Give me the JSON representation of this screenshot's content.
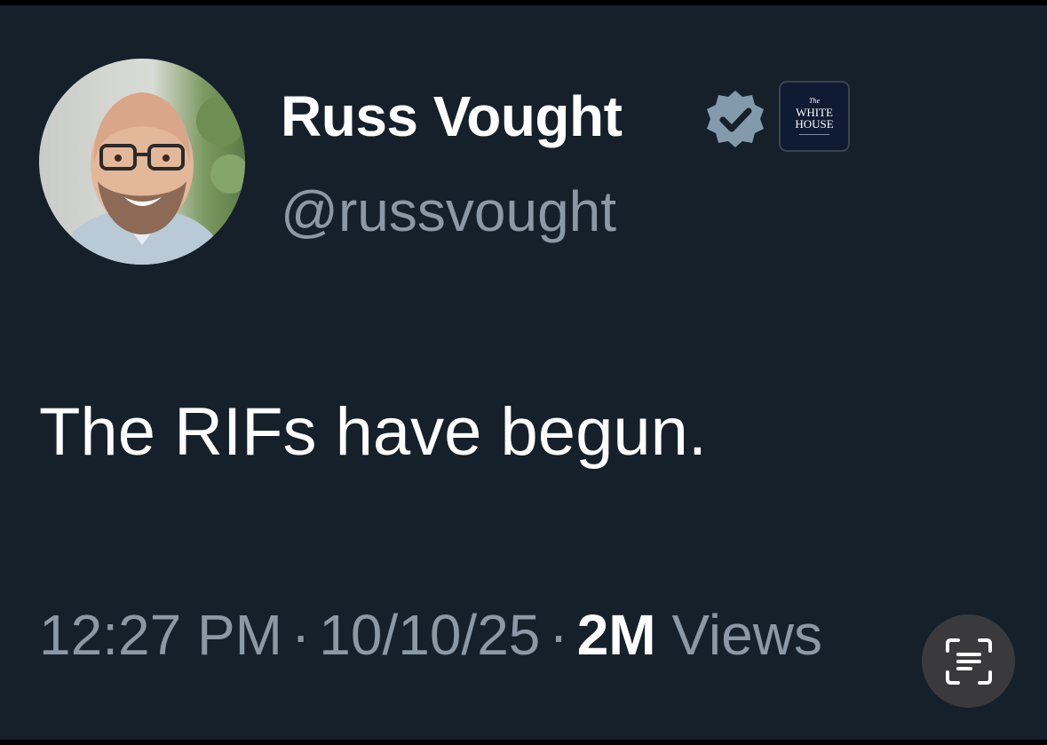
{
  "tweet": {
    "display_name": "Russ Vought",
    "handle": "@russvought",
    "verified_icon": "verified-badge-icon",
    "affiliation": {
      "line1": "The",
      "line2": "WHITE",
      "line3": "HOUSE"
    },
    "text": "The RIFs have begun.",
    "time": "12:27 PM",
    "date": "10/10/25",
    "separator": "·",
    "views_count": "2M",
    "views_label": "Views"
  },
  "overlay": {
    "scan_icon": "live-text-scan-icon"
  },
  "colors": {
    "background": "#15202b",
    "primary_text": "#ffffff",
    "secondary_text": "#8b98a5",
    "verified_badge": "#829aab"
  }
}
